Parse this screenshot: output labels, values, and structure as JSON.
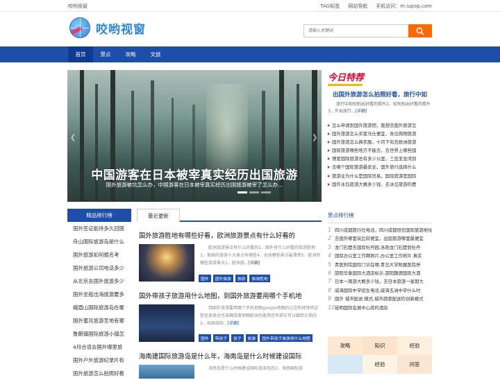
{
  "topbar": {
    "site_name": "咬哟视窗",
    "links": [
      "TAG标签",
      "网站导航",
      "手机访问：m.iupop.com"
    ]
  },
  "header": {
    "logo_text": "咬哟视窗"
  },
  "search": {
    "placeholder": "请输入关键词"
  },
  "nav": {
    "items": [
      "首页",
      "景点",
      "攻略",
      "文旅"
    ],
    "active": 0
  },
  "slider": {
    "headline": "中国游客在日本被宰真实经历出国旅游",
    "caption": "国外旅游被坑怎么办，中国游客在日本被宰真实经历出国旅游被宰了怎么办..."
  },
  "today": {
    "badge": "今日特荐",
    "title": "出国外旅游怎么拍照好看，旅行中如",
    "desc": "旅行中如何拍出好看的照片2，如何拍出好看的照片3，外出旅行...",
    "more": "[详细]",
    "list": [
      "怎么申请到国外旅游团，我想去国外旅游怎",
      "国外旅游怎么买爱马仕便宜，各位购物旅游",
      "国外旅游怎么换衣服，十月下旬去欧洲旅游",
      "国际旅游哪些地方不能去，去世界上哪些国",
      "博爱国际旅游总有多少公里，三亚亚龙湾到",
      "去哪个国际旅游最安全，国外旅行选择什么",
      "旅游业为什么是国际贸易，国际旅游是国际",
      "国外冰岛旅游大概多少钱，去冰岛旅游的费"
    ]
  },
  "rank_left": {
    "head": "精品排行榜",
    "items": [
      "国外签证能待多久回国",
      "舟山国际旅游岛是什么",
      "国外旅游如何报名考",
      "国外旅游公司电话多少",
      "从北京去国外旅游多少",
      "国外坐船出海旅游要多",
      "峨眉山国际旅游岛在哪",
      "国外蜜月旅游圣地有哪",
      "鲁朗镇国际旅游小镇怎",
      "4月合适去国外哪里旅",
      "国外户外旅游纪录片有",
      "国外旅游怎么拍照好看"
    ]
  },
  "latest": {
    "tab": "最近更新",
    "posts": [
      {
        "title": "国外旅游胜地有哪些好看，欧洲旅游景点有什么好看的",
        "excerpt": "欧洲旅游景点有什么好看的2，国外有什么好看的旅游胜地3，美国的旅游十大景点有哪些4，全球哪些景点最漂亮5，欧洲有哪些旅游景点1，欧洲旅...",
        "more": "[详细]",
        "tags": [
          "国外",
          "国外旅游",
          "旅游",
          "旅游胜地"
        ]
      },
      {
        "title": "国外带孩子旅游用什么地图，到国外旅游要用哪个手机地",
        "excerpt": "到国外旅游要用哪个手机地图google地图的公交和地铁转这些信息很全也准确百度地图欧洲也能用还有其实可以跟踪头指向2，出国自助...",
        "more": "[详细]",
        "tags": [
          "国外",
          "带孩子",
          "孩子",
          "旅游",
          "国外带孩子旅游用什么地图"
        ]
      },
      {
        "title": "海南建国际旅游岛是什么年，海南岛是什么时候建设国际",
        "excerpt": "海南岛是什么时候建设国际旅游岛的2，海南国际旅",
        "more": "",
        "tags": []
      }
    ]
  },
  "rank_right": {
    "head": "景点排行榜",
    "items": [
      "四川成都旅行社电话，四川成都恒信国际旅游地址",
      "去国外哪里玩比较便宜，出国旅游哪里最便宜",
      "龙门石窟去国际牡丹园,洛阳龙门石窟到牡丹",
      "国际办公室工作聘照片,办公室工作照片 真实",
      "青医附院国际门诊在哪,青岛大学附属医院停",
      "邵阳华泰国际大酒店标示,邵阳魏源国际大酒",
      "日本一周游大概多少钱，去日本旅游一星期大",
      "威海国际中学招生电话,威海五洲中学什么时",
      "国外 城市配送 模式,城市蔬菜配送的创新模式",
      "昆明国际会展中心旁的酒店"
    ]
  },
  "tagcloud": [
    "攻略",
    "知识",
    "经验",
    "",
    "经验",
    "问答"
  ]
}
